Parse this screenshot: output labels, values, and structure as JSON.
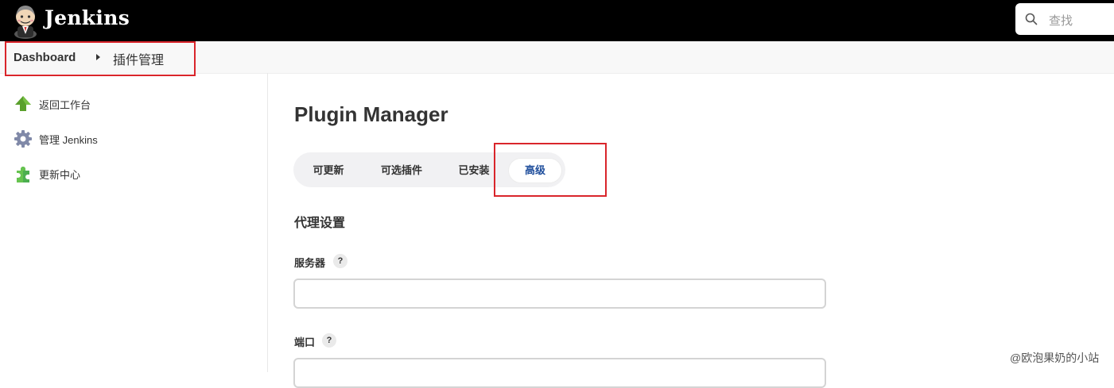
{
  "header": {
    "brand": "Jenkins",
    "logo_icon": "jenkins-butler-logo",
    "search": {
      "placeholder": "查找",
      "icon": "search-icon"
    }
  },
  "breadcrumb": {
    "items": [
      {
        "label": "Dashboard"
      },
      {
        "label": "插件管理"
      }
    ]
  },
  "sidebar": {
    "items": [
      {
        "label": "返回工作台",
        "icon": "up-arrow-icon"
      },
      {
        "label": "管理 Jenkins",
        "icon": "gear-icon"
      },
      {
        "label": "更新中心",
        "icon": "puzzle-piece-icon"
      }
    ]
  },
  "main": {
    "title": "Plugin Manager",
    "tabs": [
      {
        "label": "可更新",
        "active": false
      },
      {
        "label": "可选插件",
        "active": false
      },
      {
        "label": "已安装",
        "active": false
      },
      {
        "label": "高级",
        "active": true
      }
    ],
    "proxy": {
      "section_title": "代理设置",
      "fields": [
        {
          "label": "服务器",
          "value": "",
          "help": "?"
        },
        {
          "label": "端口",
          "value": "",
          "help": "?"
        }
      ]
    }
  },
  "watermark": "@欧泡果奶的小站",
  "colors": {
    "header_bg": "#000000",
    "highlight_box": "#d9252b",
    "active_tab_text": "#1f4e9c"
  }
}
